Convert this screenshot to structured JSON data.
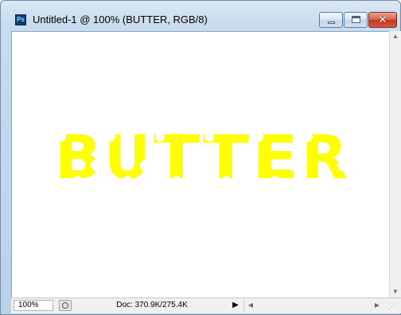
{
  "window": {
    "app_icon": "photoshop-ps-icon",
    "app_icon_text": "Ps",
    "title": "Untitled-1 @ 100% (BUTTER, RGB/8)",
    "controls": {
      "minimize_icon": "minimize-icon",
      "maximize_icon": "maximize-icon",
      "close_icon": "close-icon",
      "close_glyph": "✕"
    }
  },
  "canvas": {
    "text": "BUTTER",
    "text_color": "#ffff00",
    "background": "#ffffff"
  },
  "statusbar": {
    "zoom": "100%",
    "doc_info": "Doc: 370.9K/275.4K",
    "menu_arrow": "▶"
  },
  "colors": {
    "title_bar": "#c9dbee",
    "close_button": "#c1381d",
    "text_fill": "#ffff00"
  }
}
